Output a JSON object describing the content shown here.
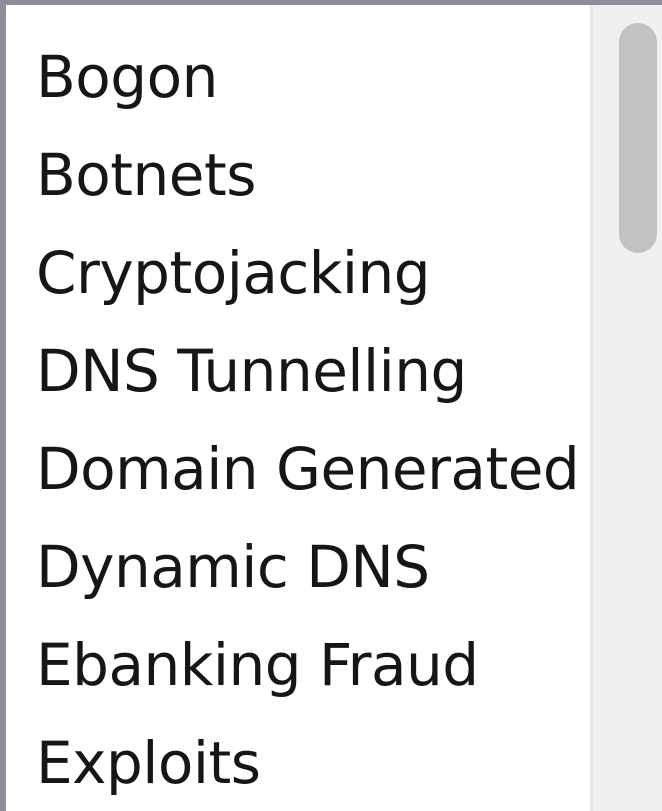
{
  "listbox": {
    "items": [
      {
        "label": "Bogon"
      },
      {
        "label": "Botnets"
      },
      {
        "label": "Cryptojacking"
      },
      {
        "label": "DNS Tunnelling"
      },
      {
        "label": "Domain Generated"
      },
      {
        "label": "Dynamic DNS"
      },
      {
        "label": "Ebanking Fraud"
      },
      {
        "label": "Exploits"
      }
    ]
  },
  "colors": {
    "border": "#8e8e9a",
    "text": "#161616",
    "scroll_track": "#f0f0f0",
    "scroll_thumb": "#c2c2c2"
  }
}
